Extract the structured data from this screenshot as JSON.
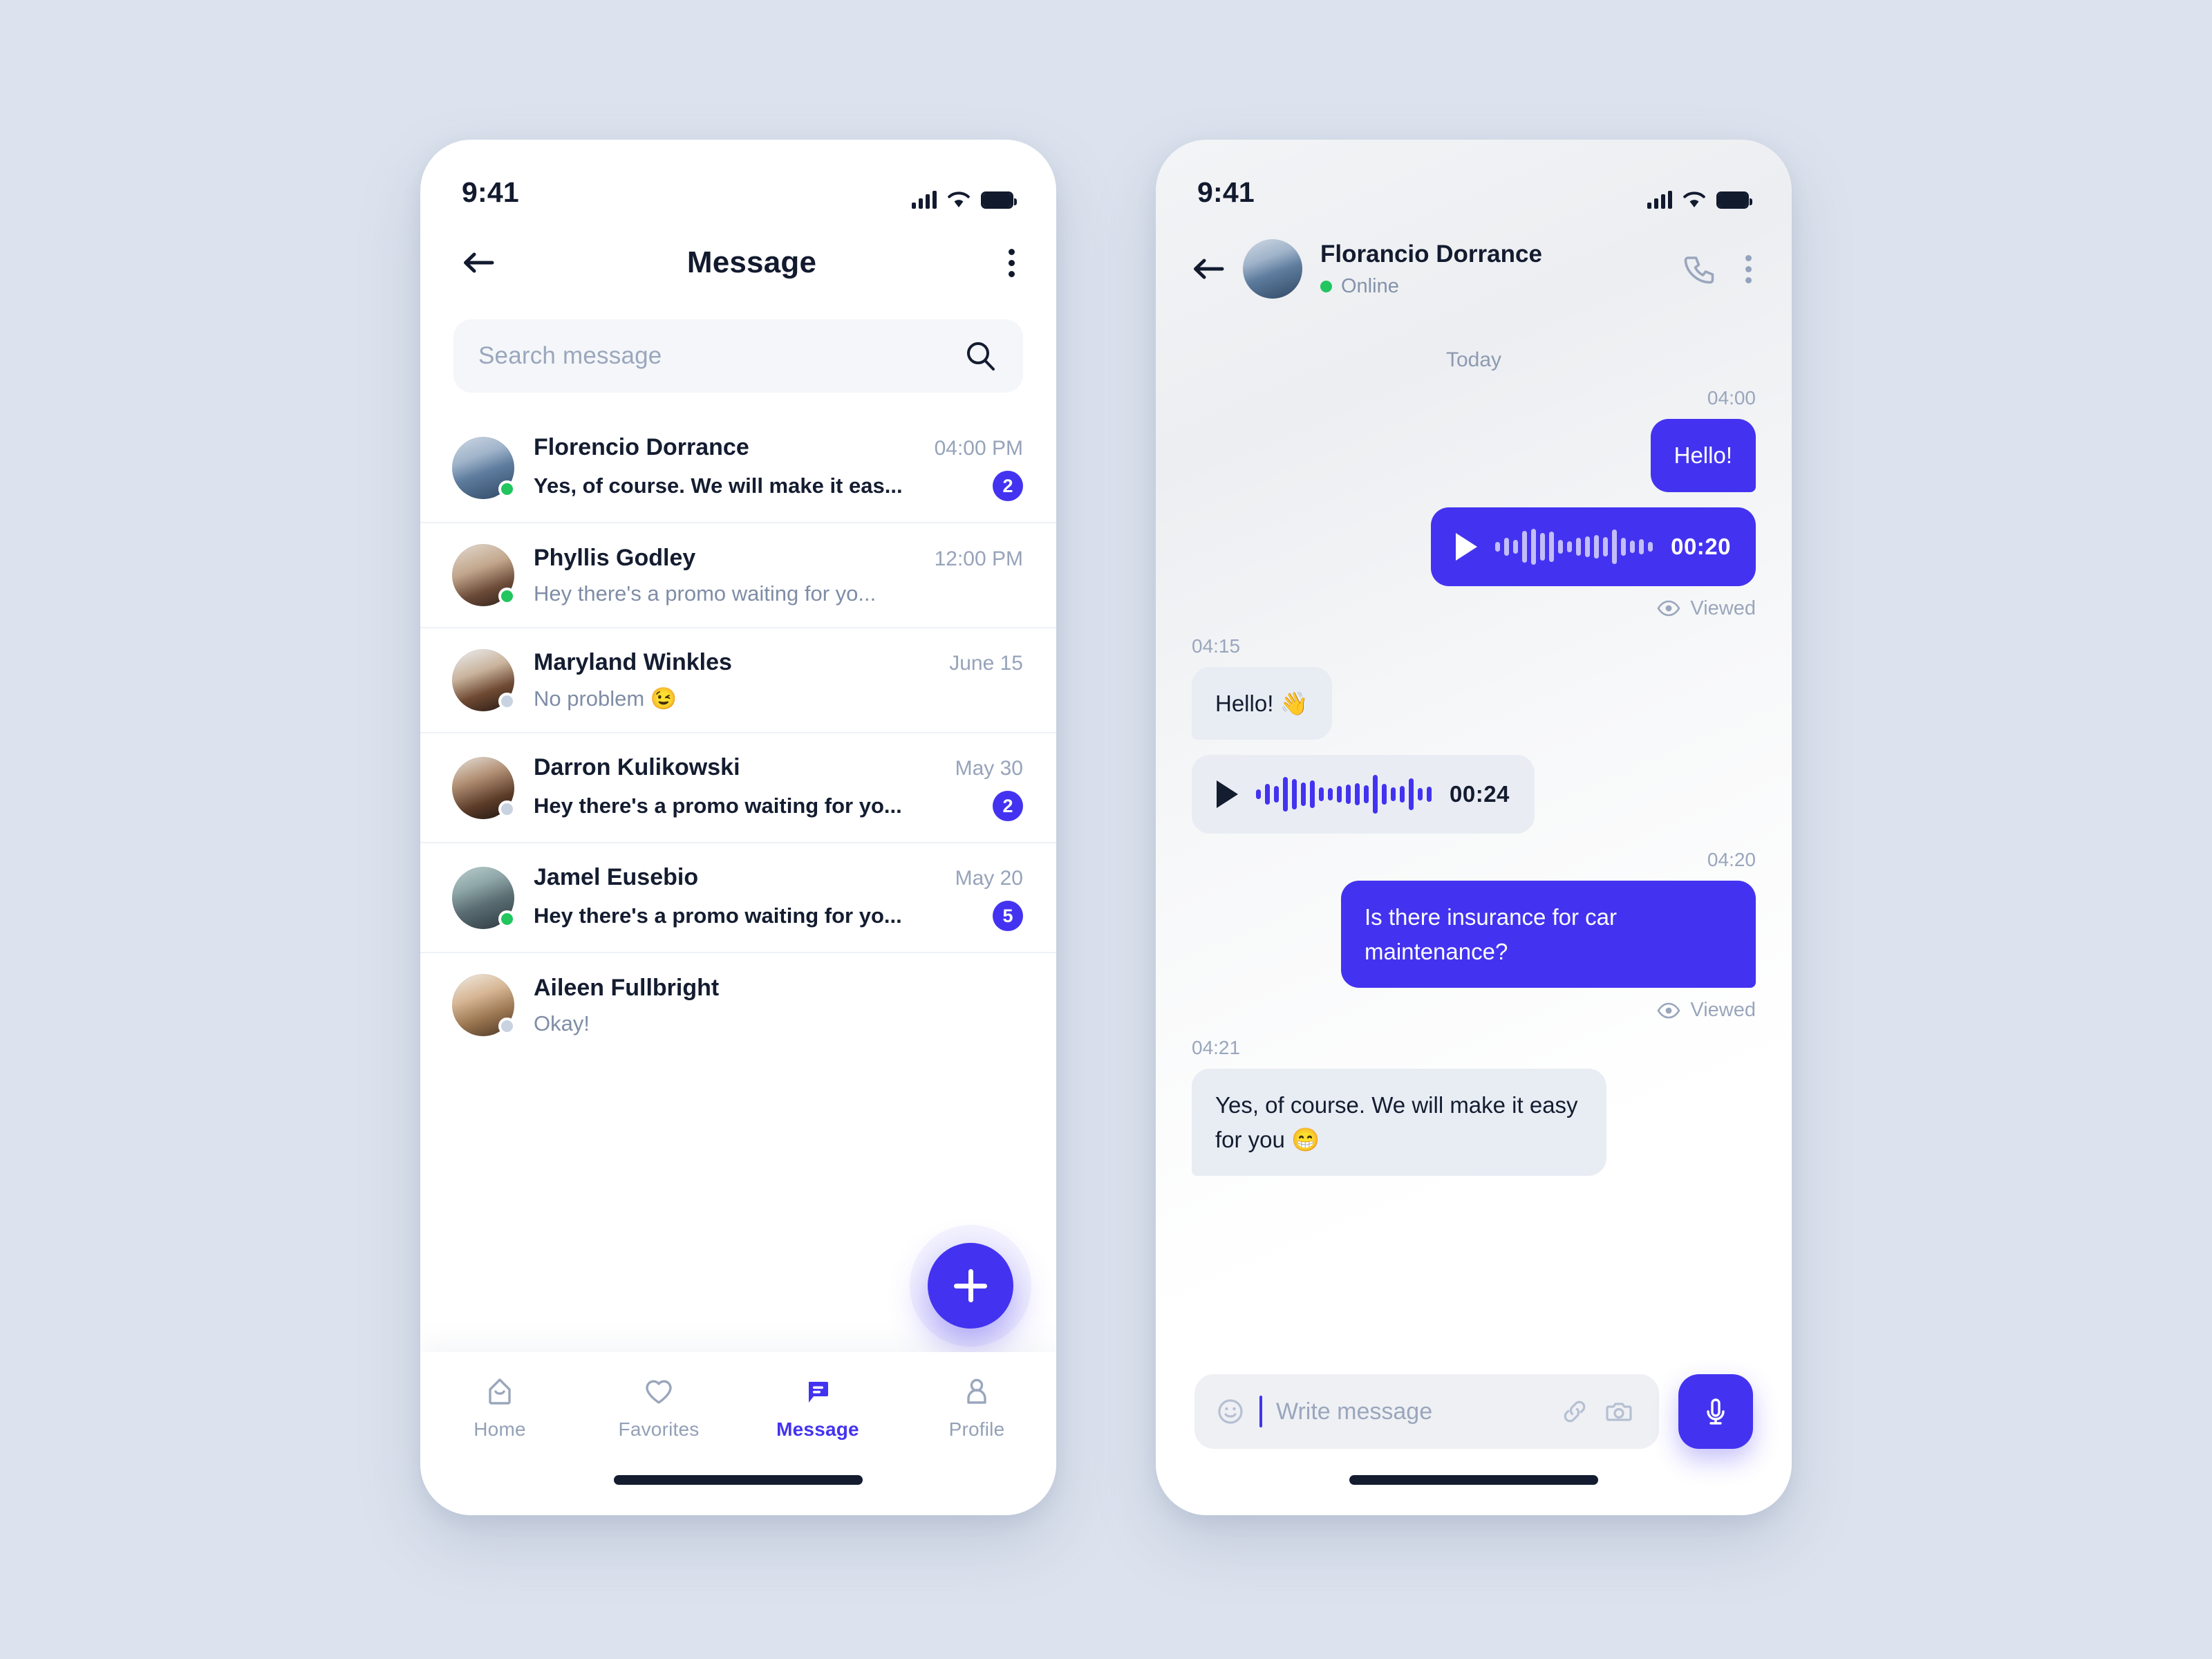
{
  "accent": "#4333F0",
  "online_color": "#22C55E",
  "offline_color": "#C9D2E0",
  "page_background": "#DCE3EE",
  "status_bar": {
    "time": "9:41",
    "signal_icon": "cellular-signal-icon",
    "wifi_icon": "wifi-icon",
    "battery_icon": "battery-full-icon"
  },
  "message_screen": {
    "back_icon": "arrow-left-icon",
    "title": "Message",
    "menu_icon": "kebab-menu-icon",
    "search": {
      "placeholder": "Search message",
      "icon": "search-icon"
    },
    "conversations": [
      {
        "name": "Florencio Dorrance",
        "time": "04:00 PM",
        "preview": "Yes, of course. We will make it eas...",
        "badge": "2",
        "presence": "online",
        "unread": true,
        "avatar_name": "avatar-florencio-dorrance"
      },
      {
        "name": "Phyllis Godley",
        "time": "12:00 PM",
        "preview": "Hey there's a promo waiting for yo...",
        "badge": "",
        "presence": "online",
        "unread": false,
        "avatar_name": "avatar-phyllis-godley"
      },
      {
        "name": "Maryland Winkles",
        "time": "June 15",
        "preview": "No problem 😉",
        "badge": "",
        "presence": "offline",
        "unread": false,
        "avatar_name": "avatar-maryland-winkles"
      },
      {
        "name": "Darron Kulikowski",
        "time": "May 30",
        "preview": "Hey there's a promo waiting for yo...",
        "badge": "2",
        "presence": "offline",
        "unread": true,
        "avatar_name": "avatar-darron-kulikowski"
      },
      {
        "name": "Jamel Eusebio",
        "time": "May 20",
        "preview": "Hey there's a promo waiting for yo...",
        "badge": "5",
        "presence": "online",
        "unread": true,
        "avatar_name": "avatar-jamel-eusebio"
      },
      {
        "name": "Aileen Fullbright",
        "time": "",
        "preview": "Okay!",
        "badge": "",
        "presence": "offline",
        "unread": false,
        "avatar_name": "avatar-aileen-fullbright"
      }
    ],
    "fab": {
      "icon": "plus-icon",
      "label": "+"
    },
    "bottom_nav": [
      {
        "label": "Home",
        "icon": "home-icon",
        "active": false
      },
      {
        "label": "Favorites",
        "icon": "heart-icon",
        "active": false
      },
      {
        "label": "Message",
        "icon": "message-icon",
        "active": true
      },
      {
        "label": "Profile",
        "icon": "person-icon",
        "active": false
      }
    ]
  },
  "chat_screen": {
    "back_icon": "arrow-left-icon",
    "contact_name": "Florancio Dorrance",
    "contact_status": "Online",
    "call_icon": "phone-icon",
    "menu_icon": "kebab-menu-icon",
    "day_separator": "Today",
    "messages": [
      {
        "kind": "text",
        "direction": "out",
        "time": "04:00",
        "text": "Hello!",
        "receipt": ""
      },
      {
        "kind": "voice",
        "direction": "out",
        "time": "",
        "duration": "00:20",
        "receipt": "Viewed",
        "receipt_icon": "eye-icon"
      },
      {
        "kind": "text",
        "direction": "in",
        "time": "04:15",
        "text": "Hello! 👋",
        "receipt": ""
      },
      {
        "kind": "voice",
        "direction": "in",
        "time": "",
        "duration": "00:24",
        "receipt": ""
      },
      {
        "kind": "text",
        "direction": "out",
        "time": "04:20",
        "text": "Is there insurance for car maintenance?",
        "receipt": "Viewed",
        "receipt_icon": "eye-icon"
      },
      {
        "kind": "text",
        "direction": "in",
        "time": "04:21",
        "text": "Yes, of course. We will make it easy for you 😁",
        "receipt": ""
      }
    ],
    "composer": {
      "emoji_icon": "smiley-icon",
      "placeholder": "Write message",
      "attach_icon": "link-icon",
      "camera_icon": "camera-icon",
      "mic_icon": "microphone-icon"
    }
  }
}
